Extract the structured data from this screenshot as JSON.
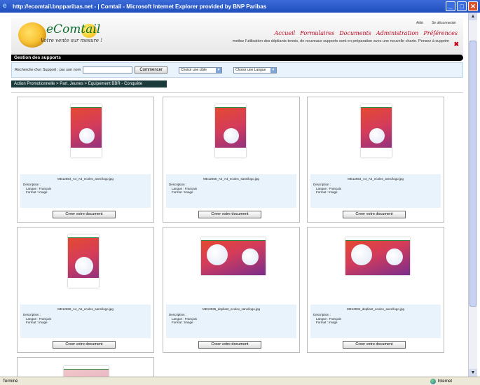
{
  "window": {
    "title": "http://ecomtail.bnpparibas.net - | Comtail - Microsoft Internet Explorer provided by BNP Paribas",
    "status_left": "Terminé",
    "status_zone": "Internet"
  },
  "header": {
    "logo_text": "eComtail",
    "logo_tagline": "Votre vente sur mesure !",
    "top_links": [
      "Aide",
      "Se déconnecter"
    ],
    "nav": [
      "Accueil",
      "Formulaires",
      "Documents",
      "Administration",
      "Préférences"
    ],
    "marquee": "mettez l'utilisation des dépliants tennis, de nouveaux supports sont en préparation avec une nouvelle charte. Pensez à supprim",
    "close_glyph": "✖"
  },
  "section_title": "Gestion des supports",
  "search": {
    "label": "Recherche d'un Support : par son nom",
    "input_value": "",
    "button": "Commencer",
    "select_cible": "Choisir une cible",
    "select_langue": "Choisir une Langue"
  },
  "breadcrumb": "Action Promotionnelle > Part. Jeunes > Equipement BBR - Conquête",
  "cards": [
    {
      "file": "ME12654_A4_A4_ecolex_avec/logo.jpg",
      "layout": "portrait",
      "desc_label": "Description :",
      "langue": "Langue : Français",
      "format": "Format : Image",
      "button": "Creer votre document"
    },
    {
      "file": "ME12656_A4_A4_ecolex_sans/logo.jpg",
      "layout": "portrait",
      "desc_label": "Description :",
      "langue": "Langue : Français",
      "format": "Format : Image",
      "button": "Creer votre document"
    },
    {
      "file": "ME12654_A4_A4_ecolex_avec/logo.jpg",
      "layout": "portrait",
      "desc_label": "Description :",
      "langue": "Langue : Français",
      "format": "Format : Image",
      "button": "Creer votre document"
    },
    {
      "file": "ME12659_A4_A5_ecolex_sans/logo.jpg",
      "layout": "portrait",
      "desc_label": "Description :",
      "langue": "Langue : Français",
      "format": "Format : Image",
      "button": "Creer votre document"
    },
    {
      "file": "ME13035_depliant_ecolex_sans/logo.jpg",
      "layout": "landscape",
      "desc_label": "Description :",
      "langue": "Langue : Français",
      "format": "Format : Image",
      "button": "Creer votre document"
    },
    {
      "file": "ME13034_depliant_ecolex_avec/logo.jpg",
      "layout": "landscape",
      "desc_label": "Description :",
      "langue": "Langue : Français",
      "format": "Format : Image",
      "button": "Creer votre document"
    },
    {
      "file": "",
      "layout": "partial",
      "desc_label": "",
      "langue": "",
      "format": "",
      "button": ""
    }
  ],
  "colors": {
    "accent_red": "#c0001a",
    "logo_green": "#0a6a2a",
    "panel_blue": "#e9f3fb",
    "breadcrumb_bg": "#1b3a3a"
  }
}
